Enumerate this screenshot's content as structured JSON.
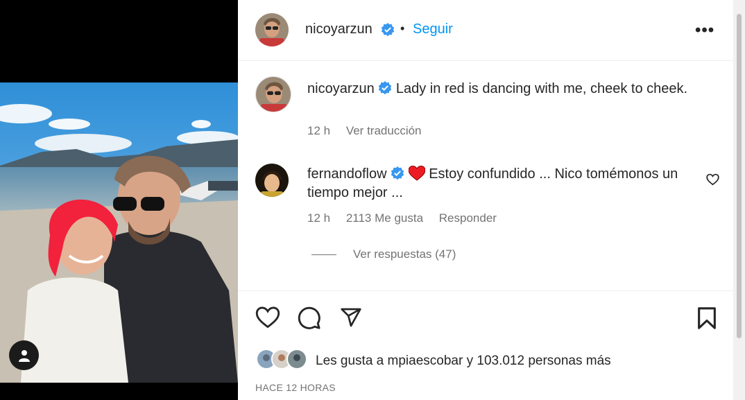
{
  "post": {
    "author": "nicoyarzun",
    "follow_label": "Seguir",
    "separator": "•",
    "more_label": "•••"
  },
  "caption": {
    "username": "nicoyarzun",
    "text": "Lady in red is dancing with me, cheek to cheek.",
    "time": "12 h",
    "translate_label": "Ver traducción"
  },
  "comment": {
    "username": "fernandoflow",
    "text": "Estoy confundido ... Nico tomémonos un tiempo mejor ...",
    "time": "12 h",
    "likes": "2113 Me gusta",
    "reply_label": "Responder",
    "view_replies": "Ver respuestas (47)"
  },
  "footer": {
    "likes_prefix": "Les gusta a",
    "likes_user": "mpiaescobar",
    "likes_suffix": "y",
    "likes_count": "103.012 personas más",
    "time_ago": "HACE 12 HORAS"
  },
  "icons": {
    "verified": "verified-badge-icon",
    "like": "heart-icon",
    "comment": "comment-bubble-icon",
    "share": "paper-plane-icon",
    "save": "bookmark-icon",
    "tag": "user-tag-icon",
    "more": "more-options-icon"
  },
  "colors": {
    "accent": "#0095f6",
    "verified": "#3897f0",
    "secondary_text": "#737373",
    "heart_red": "#ed1c24"
  }
}
